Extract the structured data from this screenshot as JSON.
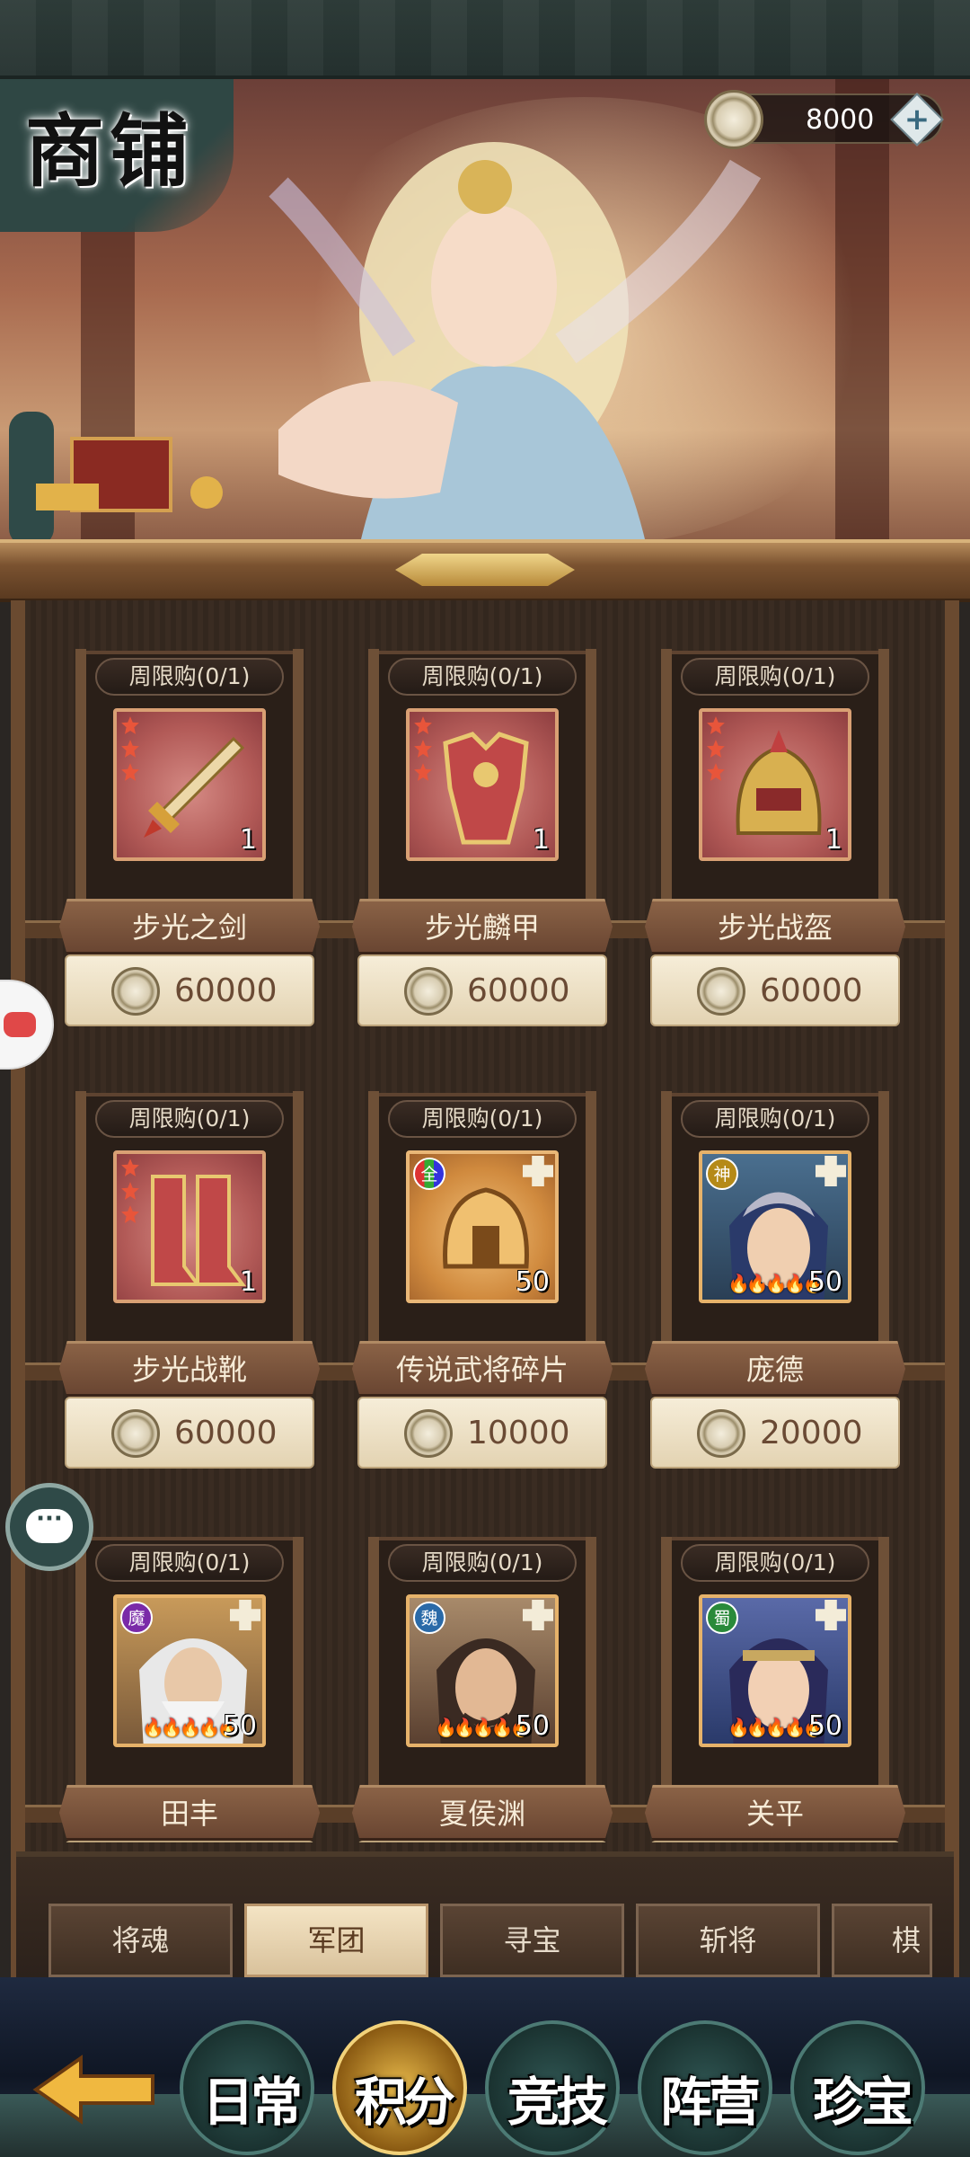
{
  "header": {
    "title": "商铺",
    "currency": {
      "icon": "coin-icon",
      "value": "8000",
      "add_icon": "plus-icon"
    }
  },
  "items": [
    {
      "limit": "周限购(0/1)",
      "name": "步光之剑",
      "qty": "1",
      "price": "60000",
      "kind": "equip",
      "stars": 3
    },
    {
      "limit": "周限购(0/1)",
      "name": "步光麟甲",
      "qty": "1",
      "price": "60000",
      "kind": "equip",
      "stars": 3
    },
    {
      "limit": "周限购(0/1)",
      "name": "步光战盔",
      "qty": "1",
      "price": "60000",
      "kind": "equip",
      "stars": 3
    },
    {
      "limit": "周限购(0/1)",
      "name": "步光战靴",
      "qty": "1",
      "price": "60000",
      "kind": "equip",
      "stars": 3
    },
    {
      "limit": "周限购(0/1)",
      "name": "传说武将碎片",
      "qty": "50",
      "price": "10000",
      "kind": "gold",
      "faction": "全"
    },
    {
      "limit": "周限购(0/1)",
      "name": "庞德",
      "qty": "50",
      "price": "20000",
      "kind": "hero",
      "faction": "神"
    },
    {
      "limit": "周限购(0/1)",
      "name": "田丰",
      "qty": "50",
      "kind": "hero",
      "faction": "魔"
    },
    {
      "limit": "周限购(0/1)",
      "name": "夏侯渊",
      "qty": "50",
      "kind": "hero",
      "faction": "魏"
    },
    {
      "limit": "周限购(0/1)",
      "name": "关平",
      "qty": "50",
      "kind": "hero",
      "faction": "蜀"
    }
  ],
  "tabs": [
    {
      "label": "将魂",
      "active": false
    },
    {
      "label": "军团",
      "active": true
    },
    {
      "label": "寻宝",
      "active": false
    },
    {
      "label": "斩将",
      "active": false
    },
    {
      "label": "棋",
      "active": false
    }
  ],
  "bottom_nav": [
    {
      "label": "日常",
      "active": false
    },
    {
      "label": "积分",
      "active": true
    },
    {
      "label": "竞技",
      "active": false
    },
    {
      "label": "阵营",
      "active": false
    },
    {
      "label": "珍宝",
      "active": false
    }
  ],
  "float": {
    "chat_icon_text": "···"
  }
}
